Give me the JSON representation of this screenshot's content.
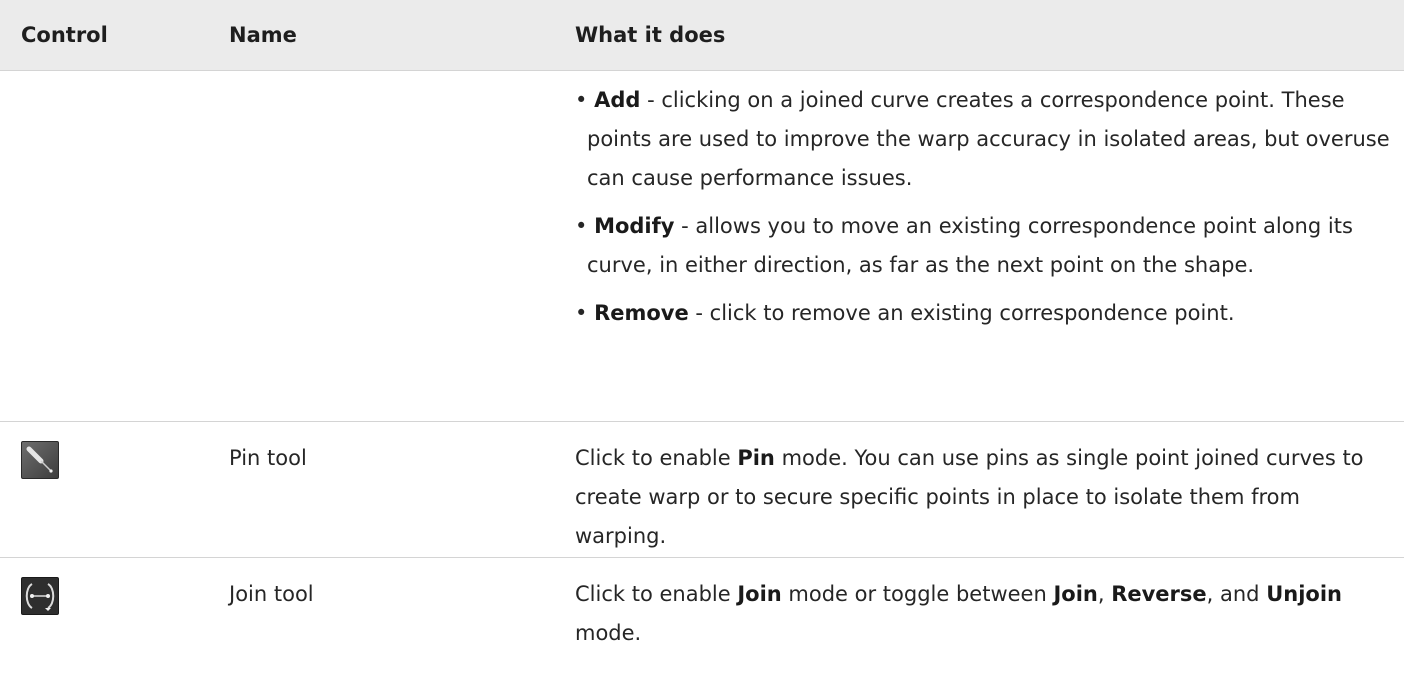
{
  "table": {
    "headers": {
      "control": "Control",
      "name": "Name",
      "description": "What it does"
    },
    "row_points": {
      "items": [
        {
          "term": "Add",
          "text": " - clicking on a joined curve creates a correspondence point. These points are used to improve the warp accuracy in isolated areas, but overuse can cause performance issues."
        },
        {
          "term": "Modify",
          "text": " - allows you to move an existing correspondence point along its curve, in either direction, as far as the next point on the shape."
        },
        {
          "term": "Remove",
          "text": " - click to remove an existing correspondence point."
        }
      ]
    },
    "row_pin": {
      "icon": "pin-tool-icon",
      "name": "Pin tool",
      "desc_before": "Click to enable ",
      "desc_bold": "Pin",
      "desc_after": " mode. You can use pins as single point joined curves to create warp or to secure specific points in place to isolate them from warping."
    },
    "row_join": {
      "icon": "join-tool-icon",
      "name": "Join tool",
      "desc_before": "Click to enable ",
      "desc_bold1": "Join",
      "desc_mid1": " mode or toggle between ",
      "desc_bold2": "Join",
      "desc_mid2": ", ",
      "desc_bold3": "Reverse",
      "desc_mid3": ", and ",
      "desc_bold4": "Unjoin",
      "desc_after": " mode."
    }
  },
  "colors": {
    "header_bg": "#ebebeb",
    "border": "#d4d4d4",
    "text": "#262626"
  }
}
